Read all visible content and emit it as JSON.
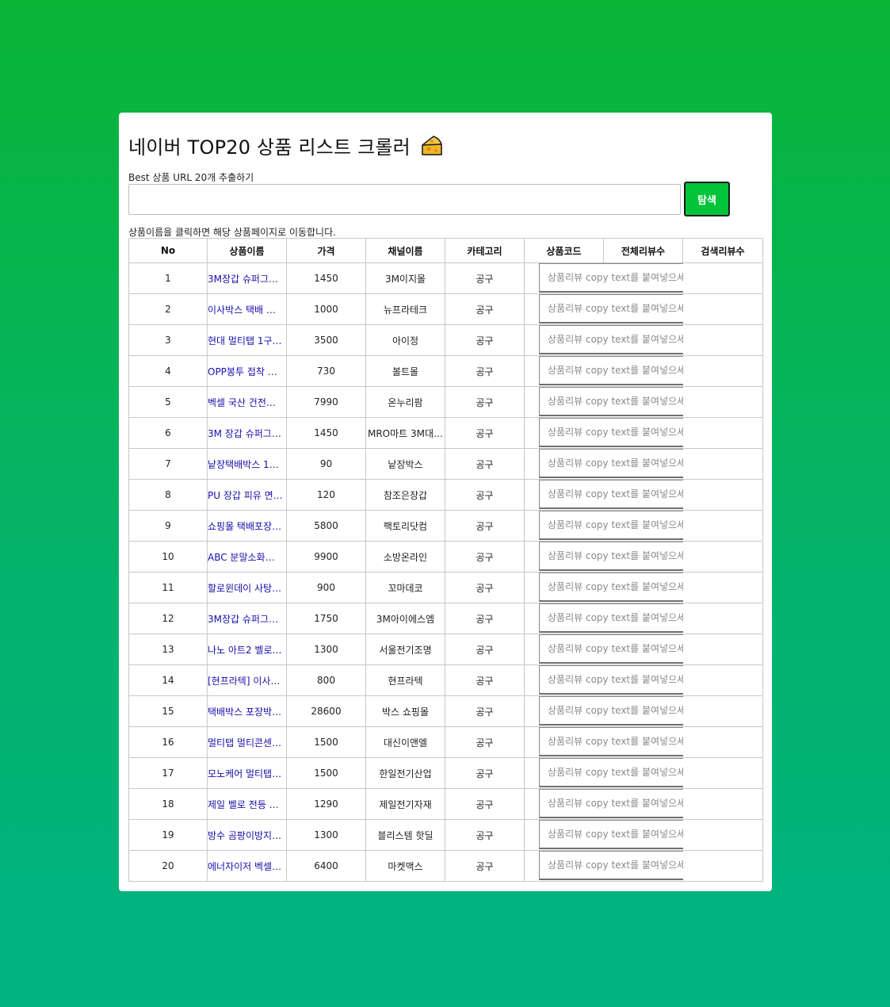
{
  "title": "네이버 TOP20 상품 리스트 크롤러",
  "url_label": "Best 상품 URL 20개 추출하기",
  "url_value": "",
  "search_button": "탐색",
  "hint": "상품이름을 클릭하면 해당 상품페이지로 이동합니다.",
  "headers": [
    "No",
    "상품이름",
    "가격",
    "채널이름",
    "카테고리",
    "상품코드",
    "전체리뷰수",
    "검색리뷰수"
  ],
  "review_placeholder": "상품리뷰 copy text를 붙여넣으세요",
  "rows": [
    {
      "no": "1",
      "name": "3M장갑 슈퍼그…",
      "price": "1450",
      "channel": "3M이지몰",
      "category": "공구"
    },
    {
      "no": "2",
      "name": "이사박스 택배 …",
      "price": "1000",
      "channel": "뉴프라테크",
      "category": "공구"
    },
    {
      "no": "3",
      "name": "현대 멀티탭 1구…",
      "price": "3500",
      "channel": "아이정",
      "category": "공구"
    },
    {
      "no": "4",
      "name": "OPP봉투 접착 …",
      "price": "730",
      "channel": "볼트몰",
      "category": "공구"
    },
    {
      "no": "5",
      "name": "벡셀 국산 건전…",
      "price": "7990",
      "channel": "온누리팜",
      "category": "공구"
    },
    {
      "no": "6",
      "name": "3M 장갑 슈퍼그…",
      "price": "1450",
      "channel": "MRO마트 3M대…",
      "category": "공구"
    },
    {
      "no": "7",
      "name": "낱장택배박스 1…",
      "price": "90",
      "channel": "낱장박스",
      "category": "공구"
    },
    {
      "no": "8",
      "name": "PU 장갑 피유 면…",
      "price": "120",
      "channel": "참조은장갑",
      "category": "공구"
    },
    {
      "no": "9",
      "name": "쇼핑몰 택배포장…",
      "price": "5800",
      "channel": "팩토리닷컴",
      "category": "공구"
    },
    {
      "no": "10",
      "name": "ABC 분말소화…",
      "price": "9900",
      "channel": "소방온라인",
      "category": "공구"
    },
    {
      "no": "11",
      "name": "할로윈데이 사탕…",
      "price": "900",
      "channel": "꼬마데코",
      "category": "공구"
    },
    {
      "no": "12",
      "name": "3M장갑 슈퍼그…",
      "price": "1750",
      "channel": "3M아이에스엠",
      "category": "공구"
    },
    {
      "no": "13",
      "name": "나노 아트2 벨로…",
      "price": "1300",
      "channel": "서울전기조명",
      "category": "공구"
    },
    {
      "no": "14",
      "name": "[현프라텍] 이사…",
      "price": "800",
      "channel": "현프라텍",
      "category": "공구"
    },
    {
      "no": "15",
      "name": "택배박스 포장박…",
      "price": "28600",
      "channel": "박스 쇼핑몰",
      "category": "공구"
    },
    {
      "no": "16",
      "name": "멀티탭 멀티콘센…",
      "price": "1500",
      "channel": "대신이앤엘",
      "category": "공구"
    },
    {
      "no": "17",
      "name": "모노케어 멀티탭…",
      "price": "1500",
      "channel": "한일전기산업",
      "category": "공구"
    },
    {
      "no": "18",
      "name": "제일 벨로 전등 …",
      "price": "1290",
      "channel": "제일전기자재",
      "category": "공구"
    },
    {
      "no": "19",
      "name": "방수 곰팡이방지…",
      "price": "1300",
      "channel": "블리스템 핫딜",
      "category": "공구"
    },
    {
      "no": "20",
      "name": "에너자이저 벡셀…",
      "price": "6400",
      "channel": "마켓맥스",
      "category": "공구"
    }
  ]
}
